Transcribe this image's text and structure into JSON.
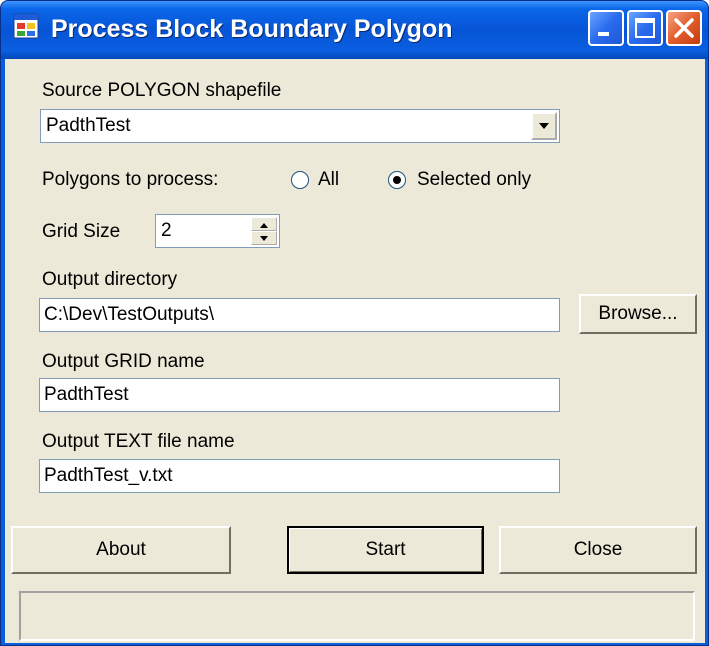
{
  "window": {
    "title": "Process Block Boundary Polygon",
    "icon": "app-window-icon",
    "controls": [
      "minimize-icon",
      "maximize-icon",
      "close-icon"
    ]
  },
  "source": {
    "label": "Source POLYGON shapefile",
    "value": "PadthTest"
  },
  "polygons": {
    "label": "Polygons to process:",
    "options": [
      {
        "label": "All",
        "checked": false
      },
      {
        "label": "Selected only",
        "checked": true
      }
    ]
  },
  "grid_size": {
    "label": "Grid Size",
    "value": "2"
  },
  "output_dir": {
    "label": "Output directory",
    "value": "C:\\Dev\\TestOutputs\\",
    "browse_label": "Browse..."
  },
  "output_grid": {
    "label": "Output GRID name",
    "value": "PadthTest"
  },
  "output_text": {
    "label": "Output TEXT file name",
    "value": "PadthTest_v.txt"
  },
  "buttons": {
    "about": "About",
    "start": "Start",
    "close": "Close"
  },
  "colors": {
    "titlebar": "#0755d6",
    "face": "#ece9d8",
    "close_button": "#e25d2c"
  }
}
